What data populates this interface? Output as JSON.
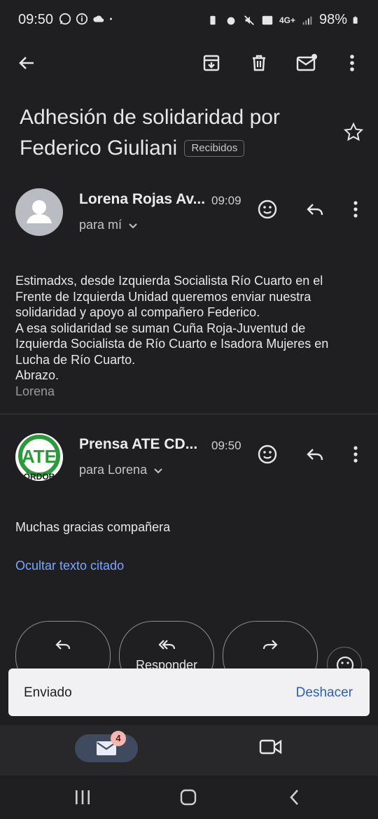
{
  "status_bar": {
    "time": "09:50",
    "battery": "98%",
    "network": "4G+"
  },
  "toolbar": {
    "back_icon": "arrow-left-icon",
    "archive_icon": "archive-icon",
    "delete_icon": "trash-icon",
    "mark_unread_icon": "mail-unread-icon",
    "more_icon": "more-vert-icon"
  },
  "email": {
    "subject": "Adhesión de solidaridad por Federico Giuliani",
    "label": "Recibidos"
  },
  "messages": [
    {
      "sender": "Lorena Rojas Av...",
      "time": "09:09",
      "recipient": "para mí",
      "body": [
        "Estimadxs, desde Izquierda Socialista Río Cuarto en el",
        "Frente de Izquierda Unidad queremos enviar nuestra",
        "solidaridad y apoyo al compañero Federico.",
        "A esa solidaridad se suman Cuña Roja-Juventud de",
        "Izquierda Socialista de Río Cuarto e Isadora Mujeres en",
        "Lucha de Río Cuarto.",
        "Abrazo."
      ],
      "signature": "Lorena"
    },
    {
      "sender": "Prensa ATE CD...",
      "time": "09:50",
      "recipient": "para Lorena",
      "avatar_text": "ATE",
      "avatar_subtext": "CÓRDOBA",
      "body": "Muchas gracias compañera",
      "quoted_toggle": "Ocultar texto citado"
    }
  ],
  "reply_bar": {
    "reply_all_label": "Responder"
  },
  "snackbar": {
    "message": "Enviado",
    "action": "Deshacer"
  },
  "bottom_nav": {
    "mail_badge": "4"
  },
  "colors": {
    "background": "#1f1f21",
    "link": "#7aa7ff",
    "ate_green": "#2a9a3a"
  }
}
